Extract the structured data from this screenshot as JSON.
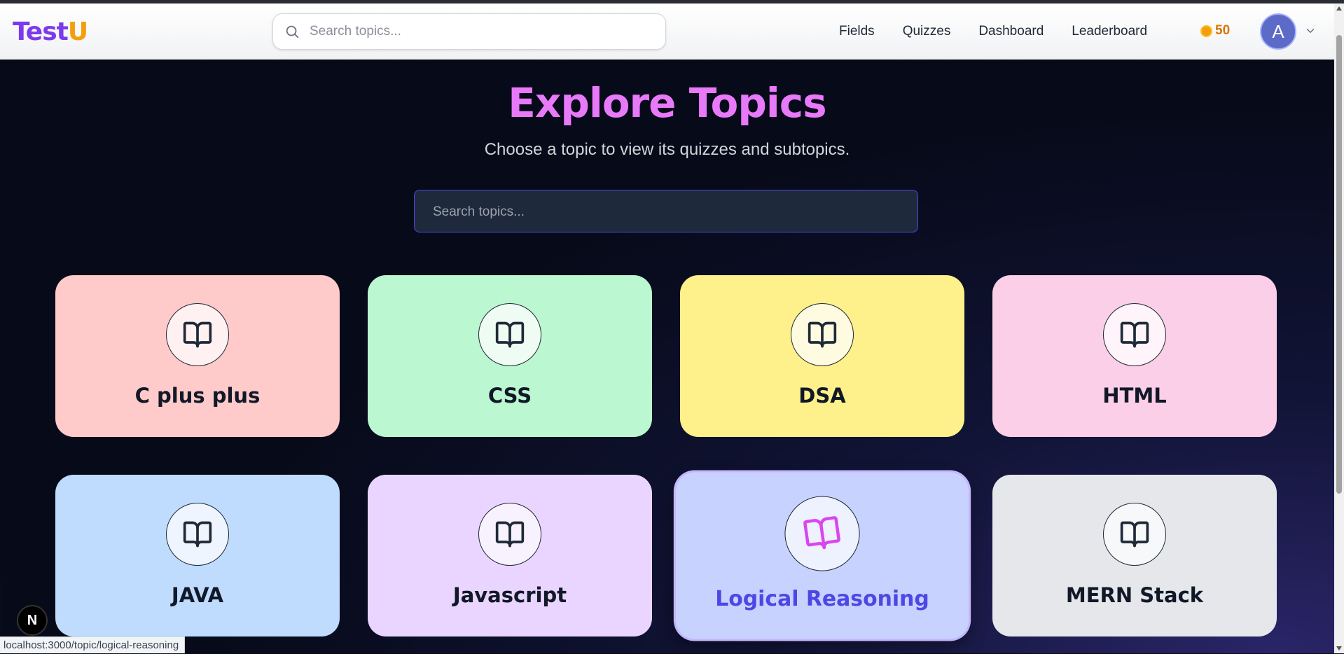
{
  "navbar": {
    "logo": {
      "part1": "Test",
      "part2": "U"
    },
    "search_placeholder": "Search topics...",
    "links": [
      "Fields",
      "Quizzes",
      "Dashboard",
      "Leaderboard"
    ],
    "coins": "50",
    "avatar_initial": "A"
  },
  "main": {
    "title": "Explore Topics",
    "subtitle": "Choose a topic to view its quizzes and subtopics.",
    "search_placeholder": "Search topics..."
  },
  "topics": [
    {
      "name": "C plus plus",
      "color": "#fecaca",
      "circle": "#fff1f1"
    },
    {
      "name": "CSS",
      "color": "#bbf7d0",
      "circle": "#effcf3"
    },
    {
      "name": "DSA",
      "color": "#fef08a",
      "circle": "#fffbe0"
    },
    {
      "name": "HTML",
      "color": "#fbcfe8",
      "circle": "#fef4fa"
    },
    {
      "name": "JAVA",
      "color": "#bfdbfe",
      "circle": "#eef5fe"
    },
    {
      "name": "Javascript",
      "color": "#e9d5ff",
      "circle": "#f8f2ff"
    },
    {
      "name": "Logical Reasoning",
      "color": "#c7d2fe",
      "circle": "#eef1fe",
      "hovered": true,
      "icon_color": "#d946ef"
    },
    {
      "name": "MERN Stack",
      "color": "#e5e7eb",
      "circle": "#f7f8f9"
    }
  ],
  "status_url": "localhost:3000/topic/logical-reasoning",
  "dev_badge": "N"
}
